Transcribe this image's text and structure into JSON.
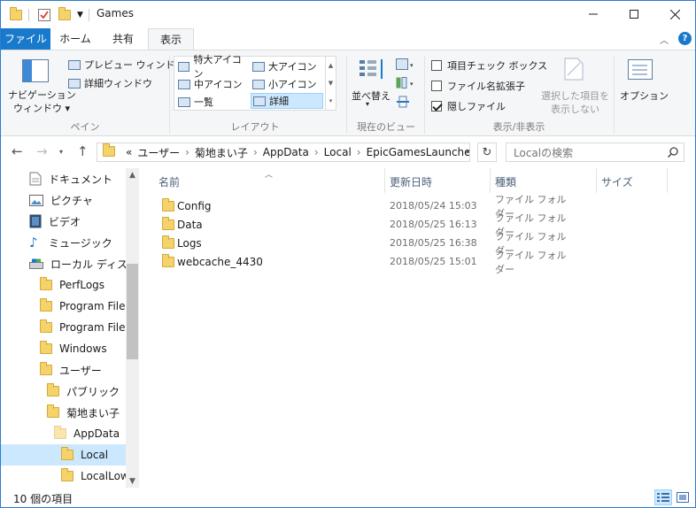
{
  "window": {
    "title": "Games"
  },
  "tabs": {
    "file": "ファイル",
    "home": "ホーム",
    "share": "共有",
    "view": "表示"
  },
  "ribbon": {
    "nav_pane_line1": "ナビゲーション",
    "nav_pane_line2": "ウィンドウ",
    "preview_pane": "プレビュー ウィンドウ",
    "details_pane": "詳細ウィンドウ",
    "group_pane": "ペイン",
    "layout_items": [
      "特大アイコン",
      "大アイコン",
      "中アイコン",
      "小アイコン",
      "一覧",
      "詳細"
    ],
    "group_layout": "レイアウト",
    "sort_by": "並べ替え",
    "group_current_view": "現在のビュー",
    "item_checkboxes": "項目チェック ボックス",
    "file_extensions": "ファイル名拡張子",
    "hidden_items": "隠しファイル",
    "hide_selected_line1": "選択した項目を",
    "hide_selected_line2": "表示しない",
    "group_show_hide": "表示/非表示",
    "options": "オプション",
    "checkbox_states": {
      "item_checkboxes": false,
      "file_extensions": false,
      "hidden_items": true
    }
  },
  "address": {
    "prefix": "«",
    "crumbs": [
      "ユーザー",
      "菊地まい子",
      "AppData",
      "Local",
      "EpicGamesLauncher"
    ],
    "search_placeholder": "Localの検索"
  },
  "nav": {
    "items": [
      {
        "label": "ドキュメント"
      },
      {
        "label": "ピクチャ"
      },
      {
        "label": "ビデオ"
      },
      {
        "label": "ミュージック"
      },
      {
        "label": "ローカル ディスク (C"
      },
      {
        "label": "PerfLogs"
      },
      {
        "label": "Program Files"
      },
      {
        "label": "Program Files ("
      },
      {
        "label": "Windows"
      },
      {
        "label": "ユーザー"
      },
      {
        "label": "パブリック"
      },
      {
        "label": "菊地まい子"
      },
      {
        "label": "AppData"
      },
      {
        "label": "Local"
      },
      {
        "label": "LocalLow"
      }
    ]
  },
  "columns": {
    "name": "名前",
    "modified": "更新日時",
    "type": "種類",
    "size": "サイズ"
  },
  "files": [
    {
      "name": "Config",
      "modified": "2018/05/24 15:03",
      "type": "ファイル フォルダー"
    },
    {
      "name": "Data",
      "modified": "2018/05/25 16:13",
      "type": "ファイル フォルダー"
    },
    {
      "name": "Logs",
      "modified": "2018/05/25 16:38",
      "type": "ファイル フォルダー"
    },
    {
      "name": "webcache_4430",
      "modified": "2018/05/25 15:01",
      "type": "ファイル フォルダー"
    }
  ],
  "status": {
    "item_count": "10 個の項目"
  },
  "colors": {
    "accent": "#1979ca",
    "selection": "#cce8ff",
    "folder": "#f5d36b"
  }
}
